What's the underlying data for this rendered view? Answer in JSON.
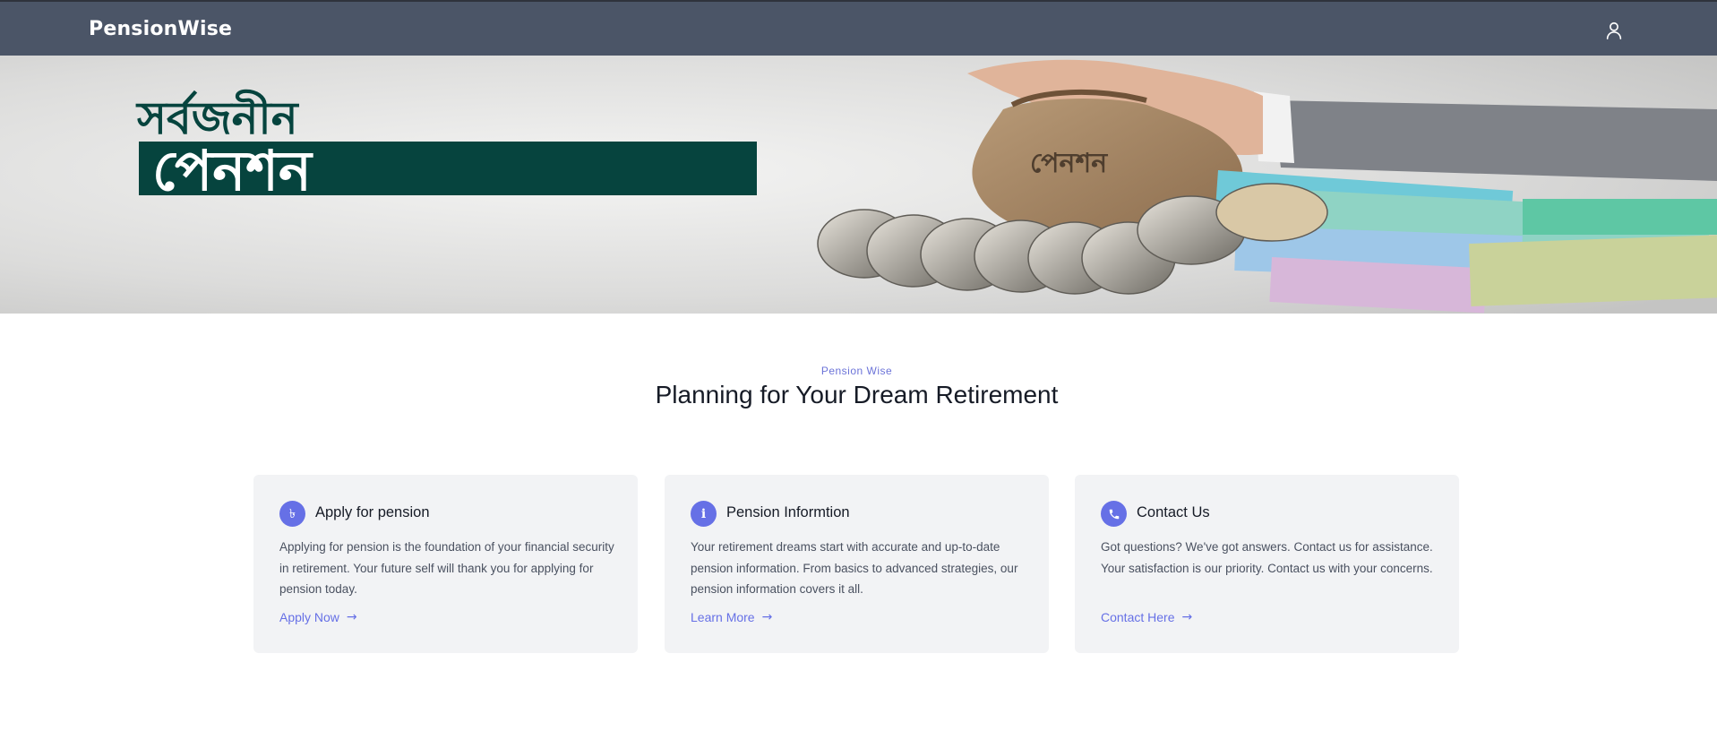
{
  "nav": {
    "brand": "PensionWise",
    "user_icon": "user-icon"
  },
  "hero": {
    "line1": "সর্বজনীন",
    "line2": "পেনশন",
    "bag_label": "পেনশন"
  },
  "section": {
    "eyebrow": "Pension Wise",
    "title": "Planning for Your Dream Retirement"
  },
  "cards": [
    {
      "icon": "taka-icon",
      "icon_glyph": "৳",
      "title": "Apply for pension",
      "text": "Applying for pension is the foundation of your financial security in retirement. Your future self will thank you for applying for pension today.",
      "link": "Apply Now"
    },
    {
      "icon": "info-icon",
      "icon_glyph": "i",
      "title": "Pension Informtion",
      "text": "Your retirement dreams start with accurate and up-to-date pension information. From basics to advanced strategies, our pension information covers it all.",
      "link": "Learn More"
    },
    {
      "icon": "phone-icon",
      "icon_glyph": "",
      "title": "Contact Us",
      "text": "Got questions? We've got answers. Contact us for assistance. Your satisfaction is our priority. Contact us with your concerns.",
      "link": "Contact Here"
    }
  ],
  "colors": {
    "navbar": "#4b5567",
    "accent": "#6670e6",
    "hero_green": "#06443e",
    "card_bg": "#f2f3f5"
  }
}
